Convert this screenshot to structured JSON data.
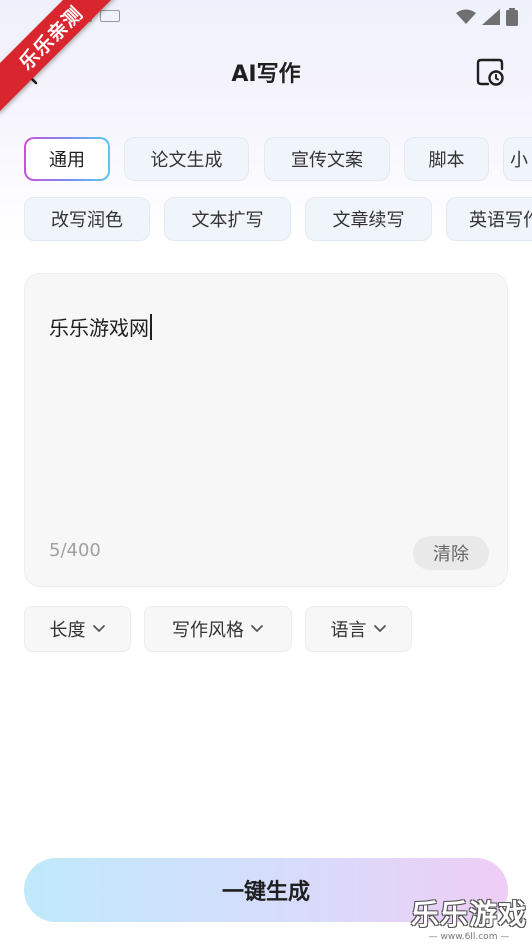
{
  "header": {
    "title": "AI写作"
  },
  "ribbon": {
    "text": "乐乐亲测"
  },
  "categories": {
    "row1": [
      "通用",
      "论文生成",
      "宣传文案",
      "脚本",
      "小"
    ],
    "row2": [
      "改写润色",
      "文本扩写",
      "文章续写",
      "英语写作"
    ],
    "active": "通用"
  },
  "editor": {
    "text": "乐乐游戏网",
    "char_count": "5/400",
    "clear_label": "清除"
  },
  "options": [
    "长度",
    "写作风格",
    "语言"
  ],
  "generate": {
    "label": "一键生成"
  },
  "watermark": {
    "main": "乐乐游戏",
    "sub": "— www.6ll.com —"
  },
  "colors": {
    "ribbon": "#d9262e",
    "gradient_start": "#bfe9fb",
    "gradient_end": "#efcdf6"
  },
  "icons": {
    "back": "back-arrow-icon",
    "history": "history-icon",
    "dropdown": "chevron-down-icon"
  }
}
